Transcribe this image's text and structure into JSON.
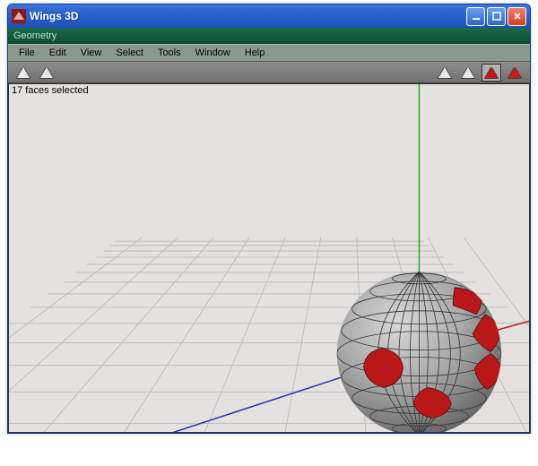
{
  "titlebar": {
    "title": "Wings 3D"
  },
  "subtitle": {
    "label": "Geometry"
  },
  "menu": {
    "file": "File",
    "edit": "Edit",
    "view": "View",
    "select": "Select",
    "tools": "Tools",
    "window": "Window",
    "help": "Help"
  },
  "toolbar": {
    "left_modes": [
      {
        "name": "mode-a",
        "color": "white"
      },
      {
        "name": "mode-b",
        "color": "white"
      }
    ],
    "right_modes": [
      {
        "name": "vertex-mode",
        "color": "white",
        "selected": false
      },
      {
        "name": "edge-mode",
        "color": "white",
        "selected": false
      },
      {
        "name": "face-mode",
        "color": "red",
        "selected": true
      },
      {
        "name": "body-mode",
        "color": "red",
        "selected": false
      }
    ]
  },
  "viewport": {
    "status": "17 faces selected",
    "selected_face_count": 17
  },
  "colors": {
    "titlebar_start": "#3b77dd",
    "titlebar_end": "#1d4db5",
    "menu_bg": "#8a9a8a",
    "toolbar_bg": "#7a7a7a",
    "viewport_bg": "#e4e2df",
    "selection": "#b81818",
    "axis_x": "#1818b8",
    "axis_y": "#18a018",
    "axis_z": "#b81818"
  }
}
